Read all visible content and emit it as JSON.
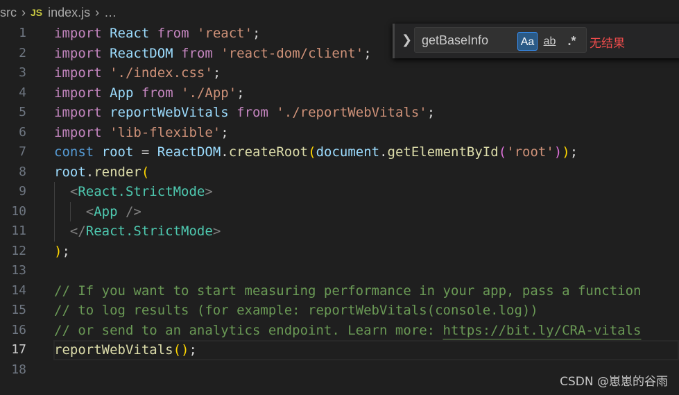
{
  "breadcrumb": {
    "folder": "src",
    "file_icon": "JS",
    "file": "index.js",
    "more": "…"
  },
  "find_widget": {
    "toggle_icon": "chevron-right-icon",
    "query": "getBaseInfo",
    "match_case_label": "Aa",
    "match_case_active": true,
    "whole_word_label": "ab",
    "regex_label": ".*",
    "status": "无结果"
  },
  "editor": {
    "current_line": 17,
    "lines": [
      {
        "n": "1",
        "tokens": [
          [
            "import",
            "kw"
          ],
          [
            " ",
            "p"
          ],
          [
            "React",
            "var"
          ],
          [
            " ",
            "p"
          ],
          [
            "from",
            "kw"
          ],
          [
            " ",
            "p"
          ],
          [
            "'react'",
            "str"
          ],
          [
            ";",
            "p"
          ]
        ]
      },
      {
        "n": "2",
        "tokens": [
          [
            "import",
            "kw"
          ],
          [
            " ",
            "p"
          ],
          [
            "ReactDOM",
            "var"
          ],
          [
            " ",
            "p"
          ],
          [
            "from",
            "kw"
          ],
          [
            " ",
            "p"
          ],
          [
            "'react-dom/client'",
            "str"
          ],
          [
            ";",
            "p"
          ]
        ]
      },
      {
        "n": "3",
        "tokens": [
          [
            "import",
            "kw"
          ],
          [
            " ",
            "p"
          ],
          [
            "'./index.css'",
            "str"
          ],
          [
            ";",
            "p"
          ]
        ]
      },
      {
        "n": "4",
        "tokens": [
          [
            "import",
            "kw"
          ],
          [
            " ",
            "p"
          ],
          [
            "App",
            "var"
          ],
          [
            " ",
            "p"
          ],
          [
            "from",
            "kw"
          ],
          [
            " ",
            "p"
          ],
          [
            "'./App'",
            "str"
          ],
          [
            ";",
            "p"
          ]
        ]
      },
      {
        "n": "5",
        "tokens": [
          [
            "import",
            "kw"
          ],
          [
            " ",
            "p"
          ],
          [
            "reportWebVitals",
            "var"
          ],
          [
            " ",
            "p"
          ],
          [
            "from",
            "kw"
          ],
          [
            " ",
            "p"
          ],
          [
            "'./reportWebVitals'",
            "str"
          ],
          [
            ";",
            "p"
          ]
        ]
      },
      {
        "n": "6",
        "tokens": [
          [
            "import",
            "kw"
          ],
          [
            " ",
            "p"
          ],
          [
            "'lib-flexible'",
            "str"
          ],
          [
            ";",
            "p"
          ]
        ]
      },
      {
        "n": "7",
        "tokens": [
          [
            "const",
            "st"
          ],
          [
            " ",
            "p"
          ],
          [
            "root",
            "var"
          ],
          [
            " = ",
            "p"
          ],
          [
            "ReactDOM",
            "var"
          ],
          [
            ".",
            "p"
          ],
          [
            "createRoot",
            "fn"
          ],
          [
            "(",
            "b1"
          ],
          [
            "document",
            "var"
          ],
          [
            ".",
            "p"
          ],
          [
            "getElementById",
            "fn"
          ],
          [
            "(",
            "b2"
          ],
          [
            "'root'",
            "str"
          ],
          [
            ")",
            "b2"
          ],
          [
            ")",
            "b1"
          ],
          [
            ";",
            "p"
          ]
        ]
      },
      {
        "n": "8",
        "tokens": [
          [
            "root",
            "var"
          ],
          [
            ".",
            "p"
          ],
          [
            "render",
            "fn"
          ],
          [
            "(",
            "b1"
          ]
        ]
      },
      {
        "n": "9",
        "tokens": [
          [
            "  ",
            "p"
          ],
          [
            "<",
            "ang"
          ],
          [
            "React.StrictMode",
            "tag"
          ],
          [
            ">",
            "ang"
          ]
        ]
      },
      {
        "n": "10",
        "tokens": [
          [
            "    ",
            "p"
          ],
          [
            "<",
            "ang"
          ],
          [
            "App",
            "tag"
          ],
          [
            " />",
            "ang"
          ]
        ]
      },
      {
        "n": "11",
        "tokens": [
          [
            "  ",
            "p"
          ],
          [
            "</",
            "ang"
          ],
          [
            "React.StrictMode",
            "tag"
          ],
          [
            ">",
            "ang"
          ]
        ]
      },
      {
        "n": "12",
        "tokens": [
          [
            ")",
            "b1"
          ],
          [
            ";",
            "p"
          ]
        ]
      },
      {
        "n": "13",
        "tokens": []
      },
      {
        "n": "14",
        "tokens": [
          [
            "// If you want to start measuring performance in your app, pass a function",
            "cm"
          ]
        ]
      },
      {
        "n": "15",
        "tokens": [
          [
            "// to log results (for example: reportWebVitals(console.log))",
            "cm"
          ]
        ]
      },
      {
        "n": "16",
        "tokens": [
          [
            "// or send to an analytics endpoint. Learn more: ",
            "cm"
          ],
          [
            "https://bit.ly/CRA-vitals",
            "link"
          ]
        ]
      },
      {
        "n": "17",
        "tokens": [
          [
            "reportWebVitals",
            "fn"
          ],
          [
            "(",
            "b1"
          ],
          [
            ")",
            "b1"
          ],
          [
            ";",
            "p"
          ]
        ]
      },
      {
        "n": "18",
        "tokens": []
      }
    ]
  },
  "watermark": "CSDN @崽崽的谷雨"
}
